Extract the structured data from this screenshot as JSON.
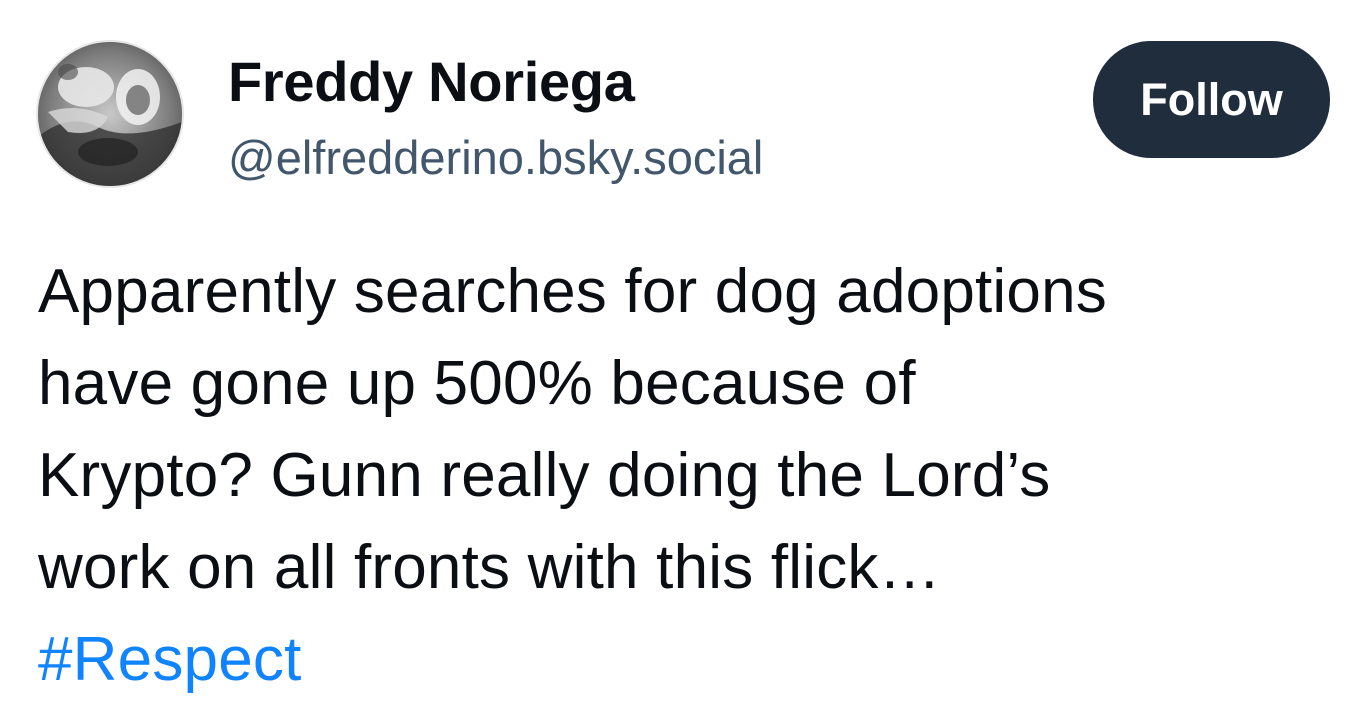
{
  "post": {
    "author": {
      "display_name": "Freddy Noriega",
      "handle": "@elfredderino.bsky.social",
      "avatar_icon": "avatar-photo-grayscale"
    },
    "follow_label": "Follow",
    "text_lines": [
      "Apparently searches for dog adoptions",
      "have gone up 500% because of",
      "Krypto? Gunn really doing the Lord’s",
      "work on all fronts with this flick…"
    ],
    "hashtag": "#Respect"
  },
  "colors": {
    "text": "#0b0f14",
    "handle": "#42576c",
    "follow_button_bg": "#1f2d3d",
    "follow_button_text": "#ffffff",
    "link": "#1083fe",
    "background": "#ffffff"
  }
}
